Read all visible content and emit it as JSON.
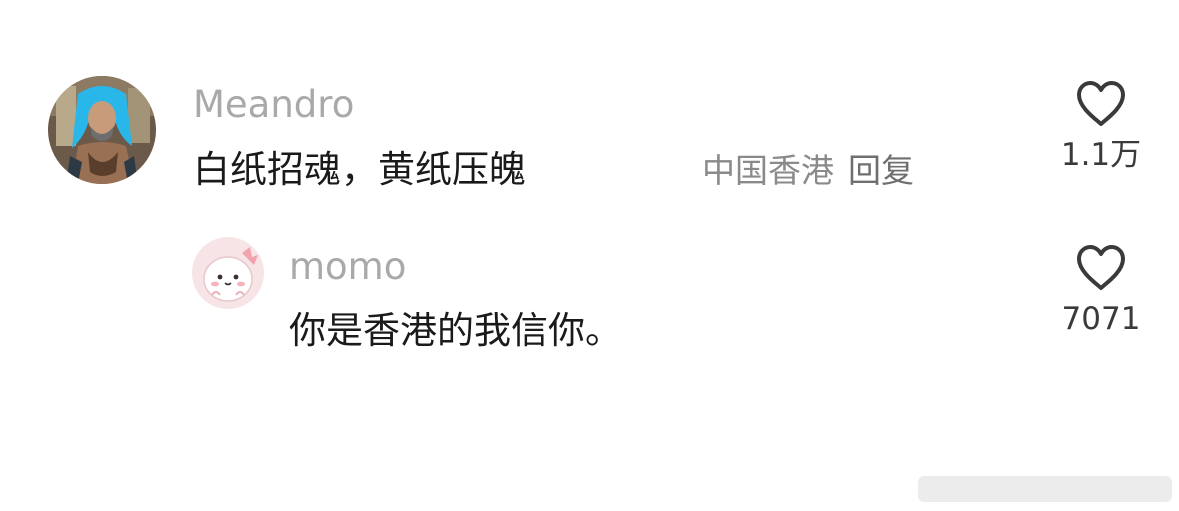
{
  "comments": [
    {
      "username": "Meandro",
      "text": "白纸招魂，黄纸压魄",
      "location": "中国香港",
      "reply_label": "回复",
      "likes": "1.1万",
      "avatar_icon": "avatar-photo"
    },
    {
      "username": "momo",
      "text": "你是香港的我信你。",
      "likes": "7071",
      "avatar_icon": "avatar-cartoon"
    }
  ],
  "colors": {
    "username": "#a9a9a9",
    "text": "#1a1a1a",
    "meta": "#8a8a8a"
  }
}
